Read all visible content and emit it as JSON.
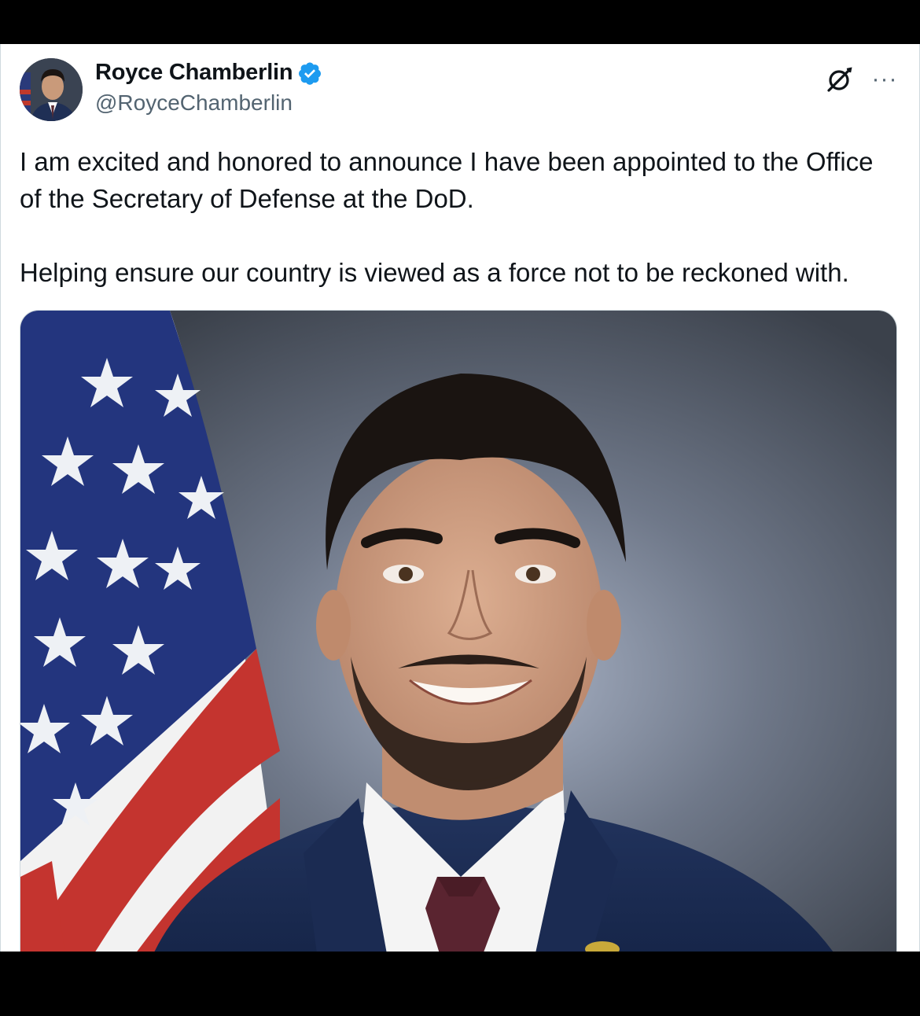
{
  "tweet": {
    "author": {
      "display_name": "Royce Chamberlin",
      "handle": "@RoyceChamberlin",
      "verified": true,
      "verified_color": "#1d9bf0",
      "avatar_icon": "user-avatar"
    },
    "text_lines": [
      "I am excited and honored to announce I have been appointed to the Office of the Secretary of Defense at the DoD.",
      "Helping ensure our country is viewed as a force not to be reckoned with."
    ],
    "actions": {
      "grok_icon": "grok-icon",
      "more_label": "···"
    },
    "media": {
      "type": "photo",
      "subject": "portrait-photo"
    }
  },
  "colors": {
    "text_primary": "#0f1419",
    "text_secondary": "#536471",
    "border": "#cfd9de",
    "frame": "#000000"
  }
}
